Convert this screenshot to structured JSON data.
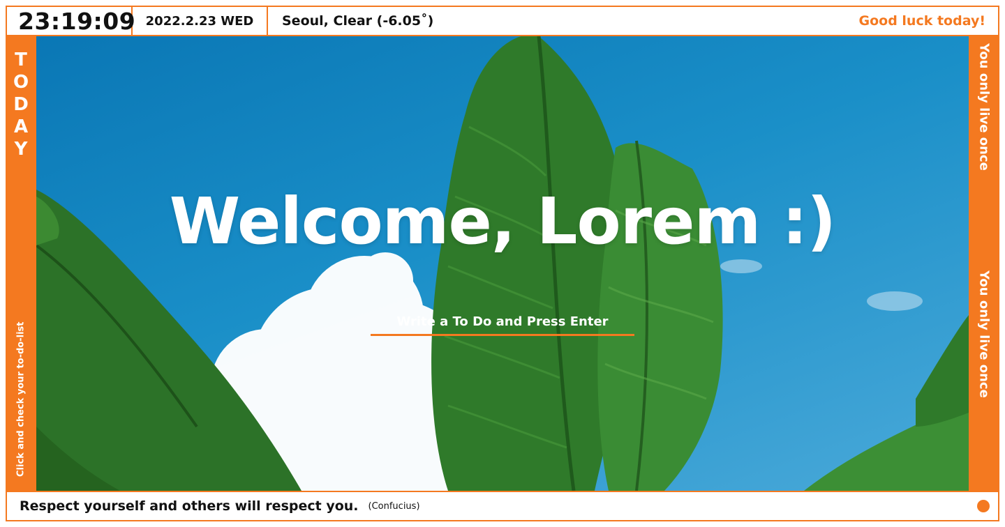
{
  "header": {
    "clock": "23:19:09",
    "date": "2022.2.23 WED",
    "weather": "Seoul, Clear (-6.05˚)",
    "greeting": "Good luck today!"
  },
  "left_rail": {
    "today_letters": [
      "T",
      "O",
      "D",
      "A",
      "Y"
    ],
    "todo_link": "Click and check your to-do-list"
  },
  "right_rail": {
    "motto_top": "You only live once",
    "motto_bottom": "You only live once"
  },
  "main": {
    "welcome": "Welcome, Lorem :)",
    "todo_placeholder": "Write a To Do and Press Enter"
  },
  "footer": {
    "quote": "Respect yourself and others will respect you.",
    "author": "(Confucius)"
  },
  "colors": {
    "accent": "#f47920",
    "sky": "#1a8fc8",
    "leaf": "#2f7a2a"
  }
}
